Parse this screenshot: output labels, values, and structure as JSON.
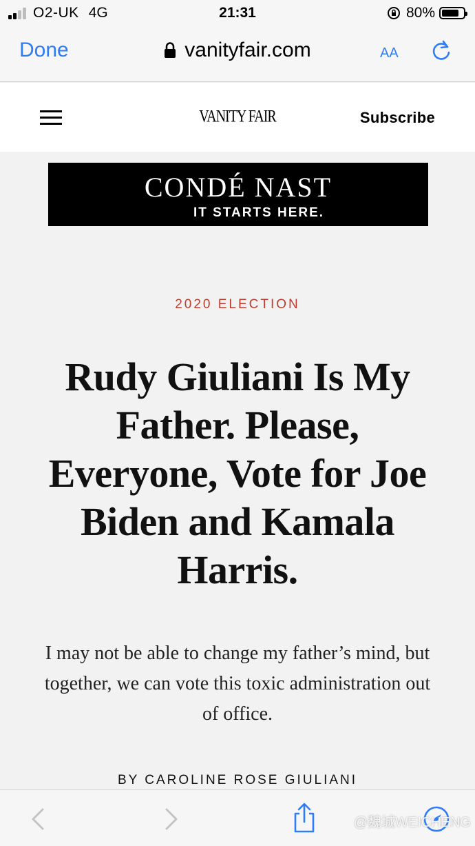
{
  "status_bar": {
    "carrier": "O2-UK",
    "network": "4G",
    "time": "21:31",
    "battery": "80%",
    "battery_level": 0.8
  },
  "browser": {
    "done_label": "Done",
    "url": "vanityfair.com",
    "text_size_label": "AA",
    "accent_color": "#2f7cf6"
  },
  "site": {
    "logo": "VANITY FAIR",
    "subscribe_label": "Subscribe"
  },
  "ad": {
    "title": "CONDÉ NAST",
    "subtitle": "IT STARTS HERE."
  },
  "article": {
    "rubric": "2020 ELECTION",
    "rubric_color": "#c23b2c",
    "headline": "Rudy Giuliani Is My Father. Please, Everyone, Vote for Joe Biden and Kamala Harris.",
    "dek": "I may not be able to change my father’s mind, but together, we can vote this toxic administration out of office.",
    "byline": "BY CAROLINE ROSE GIULIANI"
  },
  "toolbar": {
    "icons": [
      "chevron-left-icon",
      "chevron-right-icon",
      "share-icon",
      "compass-icon"
    ],
    "watermark": "@魏城WEICHENG"
  }
}
